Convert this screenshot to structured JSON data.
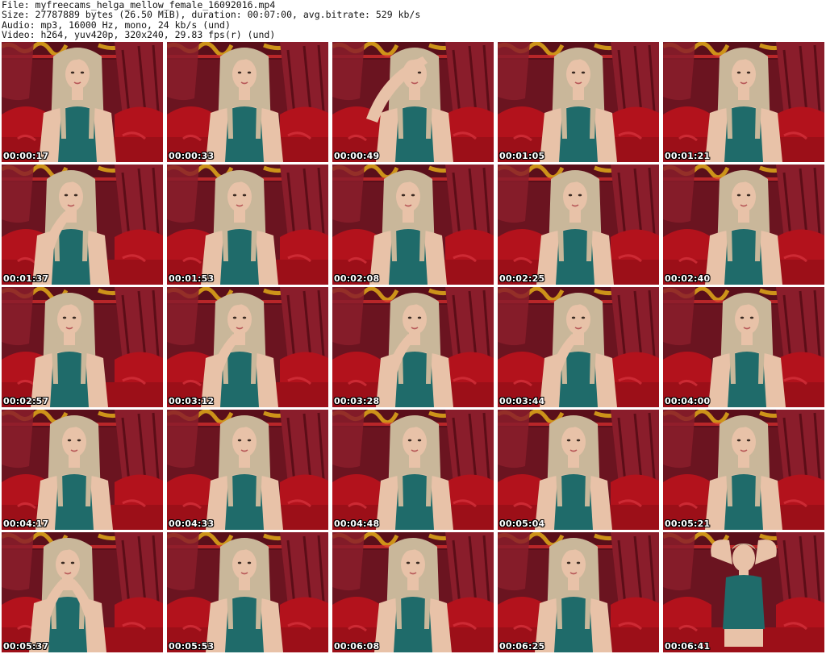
{
  "header": {
    "line1": "File: myfreecams_helga_mellow_female_16092016.mp4",
    "line2": "Size: 27787889 bytes (26.50 MiB), duration: 00:07:00, avg.bitrate: 529 kb/s",
    "line3": "Audio: mp3, 16000 Hz, mono, 24 kb/s (und)",
    "line4": "Video: h264, yuv420p, 320x240, 29.83 fps(r) (und)"
  },
  "frames": [
    {
      "time": "00:00:17",
      "pose": "neutral"
    },
    {
      "time": "00:00:33",
      "pose": "neutral"
    },
    {
      "time": "00:00:49",
      "pose": "arm-up"
    },
    {
      "time": "00:01:05",
      "pose": "neutral"
    },
    {
      "time": "00:01:21",
      "pose": "neutral"
    },
    {
      "time": "00:01:37",
      "pose": "hand-face"
    },
    {
      "time": "00:01:53",
      "pose": "neutral"
    },
    {
      "time": "00:02:08",
      "pose": "tilt"
    },
    {
      "time": "00:02:25",
      "pose": "neutral"
    },
    {
      "time": "00:02:40",
      "pose": "neutral"
    },
    {
      "time": "00:02:57",
      "pose": "neutral"
    },
    {
      "time": "00:03:12",
      "pose": "hand-chin"
    },
    {
      "time": "00:03:28",
      "pose": "hand-chin"
    },
    {
      "time": "00:03:44",
      "pose": "hand-chin"
    },
    {
      "time": "00:04:00",
      "pose": "neutral"
    },
    {
      "time": "00:04:17",
      "pose": "neutral"
    },
    {
      "time": "00:04:33",
      "pose": "neutral"
    },
    {
      "time": "00:04:48",
      "pose": "neutral"
    },
    {
      "time": "00:05:04",
      "pose": "neutral"
    },
    {
      "time": "00:05:21",
      "pose": "neutral"
    },
    {
      "time": "00:05:37",
      "pose": "hands-face"
    },
    {
      "time": "00:05:53",
      "pose": "neutral"
    },
    {
      "time": "00:06:08",
      "pose": "neutral"
    },
    {
      "time": "00:06:25",
      "pose": "neutral"
    },
    {
      "time": "00:06:41",
      "pose": "arms-up"
    }
  ],
  "colors": {
    "background_wall": "#6b1420",
    "curtain": "#8a1d2b",
    "sofa": "#b3121c",
    "gold_trim": "#d9a21a",
    "hair": "#c9b79a",
    "skin": "#e8c2a8",
    "top": "#1f6b6a"
  }
}
